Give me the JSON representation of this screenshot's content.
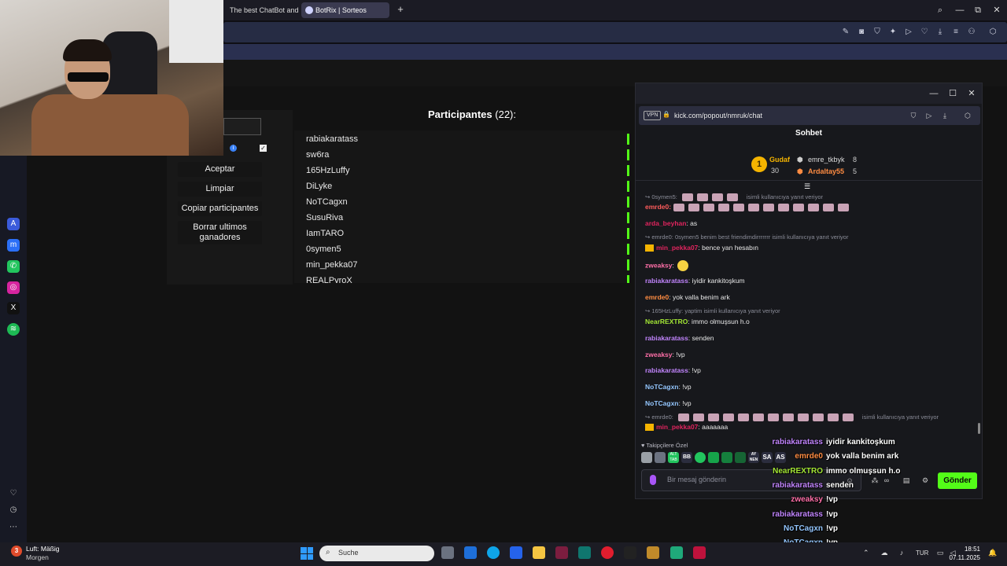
{
  "browser": {
    "tabs": [
      {
        "label": "The best ChatBot and Wi"
      },
      {
        "label": "BotRix | Sorteos"
      }
    ],
    "new_tab": "+",
    "window_controls": {
      "search": "⌕",
      "minimize": "—",
      "restore": "⧉",
      "close": "✕"
    }
  },
  "page": {
    "participants_title": "Participantes",
    "participants_count": "(22):",
    "buttons": {
      "accept": "Aceptar",
      "clear": "Limpiar",
      "copy": "Copiar participantes",
      "delete_winners": "Borrar ultimos ganadores"
    },
    "participants": [
      "rabiakaratass",
      "sw6ra",
      "165HzLuffy",
      "DiLyke",
      "NoTCagxn",
      "SusuRiva",
      "IamTARO",
      "0symen5",
      "min_pekka07",
      "REALPyroX"
    ],
    "kick_badge": "K"
  },
  "chat": {
    "url": "kick.com/popout/nmruk/chat",
    "vpn": "VPN",
    "title": "Sohbet",
    "leaderboard": {
      "rank": "1",
      "first": {
        "name": "Gudaf",
        "count": "30"
      },
      "second": {
        "name": "emre_tkbyk",
        "count": "8"
      },
      "third": {
        "name": "Ardaltay55",
        "count": "5"
      }
    },
    "messages": [
      {
        "reply": "↪ 0symen5:",
        "reply_tail": "isimli kullanıcıya yanıt veriyor"
      },
      {
        "user": "emrde0:",
        "color": "#ff5c5c",
        "emotes": 12
      },
      {
        "user": "arda_beyhan",
        "color": "#e0245e",
        "text": ": as"
      },
      {
        "reply": "↪ emrde0: 0symen5 benim best friendimdirrrrrrr isimli kullanıcıya yanıt veriyor"
      },
      {
        "user": "min_pekka07",
        "color": "#e0245e",
        "text": ": bence yan hesabın",
        "crown": true
      },
      {
        "user": "zweaksy",
        "color": "#ff6fa8",
        "text": ":"
      },
      {
        "user": "rabiakaratass",
        "color": "#c084fc",
        "text": ": iyidir kankitoşkum"
      },
      {
        "user": "emrde0",
        "color": "#ff8c42",
        "text": ": yok valla benim ark"
      },
      {
        "reply": "↪ 165HzLuffy: yaptim isimli kullanıcıya yanıt veriyor"
      },
      {
        "user": "NearREXTRO",
        "color": "#a3e635",
        "text": ": immo olmuşsun h.o"
      },
      {
        "user": "rabiakaratass",
        "color": "#c084fc",
        "text": ": senden"
      },
      {
        "user": "zweaksy",
        "color": "#ff6fa8",
        "text": ": !vp"
      },
      {
        "user": "rabiakaratass",
        "color": "#c084fc",
        "text": ": !vp"
      },
      {
        "user": "NoTCagxn",
        "color": "#93c5fd",
        "text": ": !vp"
      },
      {
        "user": "NoTCagxn",
        "color": "#93c5fd",
        "text": ": !vp"
      },
      {
        "reply": "↪ emrde0:",
        "reply_tail": "isimli kullanıcıya yanıt veriyor"
      },
      {
        "user": "min_pekka07",
        "color": "#e0245e",
        "text": ": aaaaaaa",
        "crown": true
      }
    ],
    "followers_only": "♥ Takipçilere Özel",
    "emote_labels": [
      "ALT TAB",
      "BB",
      "AY NEN",
      "SA",
      "AS"
    ],
    "input_placeholder": "Bir mesaj gönderin",
    "send": "Gönder"
  },
  "overlay": [
    {
      "user": "rabiakaratass",
      "color": "#c084fc",
      "text": "iyidir kankitoşkum"
    },
    {
      "user": "emrde0",
      "color": "#ff8c42",
      "text": "yok valla benim ark"
    },
    {
      "user": "NearREXTRO",
      "color": "#a3e635",
      "text": "immo olmuşsun h.o"
    },
    {
      "user": "rabiakaratass",
      "color": "#c084fc",
      "text": "senden"
    },
    {
      "user": "zweaksy",
      "color": "#ff6fa8",
      "text": "!vp"
    },
    {
      "user": "rabiakaratass",
      "color": "#c084fc",
      "text": "!vp"
    },
    {
      "user": "NoTCagxn",
      "color": "#93c5fd",
      "text": "!vp"
    },
    {
      "user": "NoTCagxn",
      "color": "#93c5fd",
      "text": "!vp"
    },
    {
      "user": "min_pekka07",
      "color": "#e0245e",
      "text": "aaaaaaa"
    }
  ],
  "taskbar": {
    "weather_title": "Luft: Mäßig",
    "weather_sub": "Morgen",
    "weather_badge": "3",
    "search": "Suche",
    "lang": "TUR",
    "time": "18:51",
    "date": "07.11.2025"
  },
  "colors": {
    "kick_green": "#53fc18",
    "accent_purple": "#a855f7"
  }
}
